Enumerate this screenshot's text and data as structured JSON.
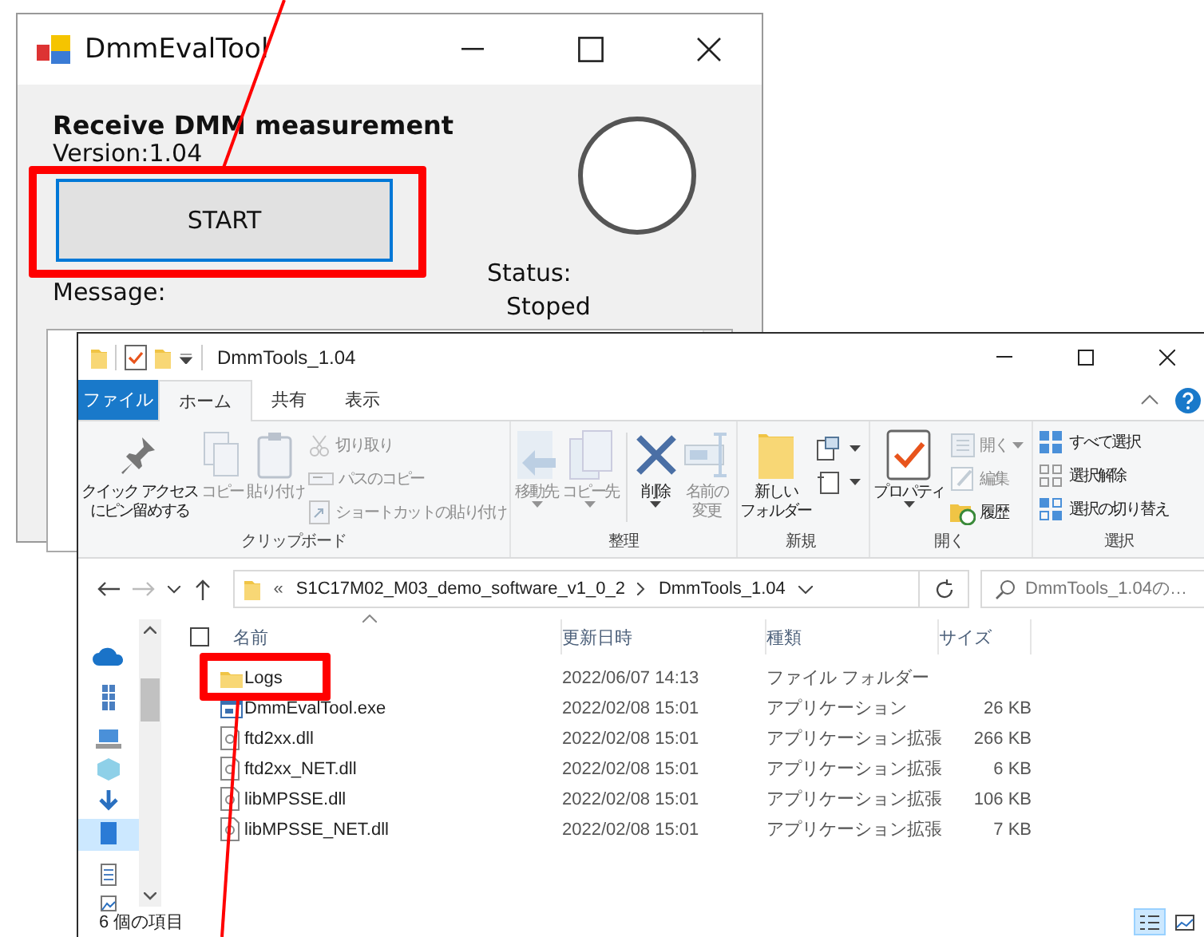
{
  "app_window": {
    "title": "DmmEvalTool",
    "heading": "Receive DMM measurement",
    "version": "Version:1.04",
    "start_button": "START",
    "status_label": "Status:",
    "status_value": "Stoped",
    "message_label": "Message:"
  },
  "explorer": {
    "title": "DmmTools_1.04",
    "ribbon_tabs": [
      {
        "label": "ファイル",
        "kind": "file",
        "selected": false
      },
      {
        "label": "ホーム",
        "kind": "tab",
        "selected": true
      },
      {
        "label": "共有",
        "kind": "tab",
        "selected": false
      },
      {
        "label": "表示",
        "kind": "tab",
        "selected": false
      }
    ],
    "ribbon_groups": [
      {
        "label": "クリップボード",
        "commands": [
          {
            "lines": [
              "クイック アクセス",
              "にピン留めする"
            ],
            "kind": "large",
            "disabled": false
          },
          {
            "lines": [
              "コピー"
            ],
            "kind": "large",
            "disabled": true
          },
          {
            "lines": [
              "貼り付け"
            ],
            "kind": "large",
            "disabled": true
          },
          {
            "label": "切り取り",
            "kind": "small",
            "disabled": true
          },
          {
            "label": "パスのコピー",
            "kind": "small",
            "disabled": true
          },
          {
            "label": "ショートカットの貼り付け",
            "kind": "small",
            "disabled": true
          }
        ]
      },
      {
        "label": "整理",
        "commands": [
          {
            "lines": [
              "移動先"
            ],
            "kind": "large",
            "disabled": true,
            "dropdown": true
          },
          {
            "lines": [
              "コピー先"
            ],
            "kind": "large",
            "disabled": true,
            "dropdown": true
          },
          {
            "lines": [
              "削除"
            ],
            "kind": "large",
            "disabled": false,
            "dropdown": true
          },
          {
            "lines": [
              "名前の",
              "変更"
            ],
            "kind": "large",
            "disabled": true
          }
        ]
      },
      {
        "label": "新規",
        "commands": [
          {
            "lines": [
              "新しい",
              "フォルダー"
            ],
            "kind": "large",
            "disabled": false
          },
          {
            "kind": "icon",
            "disabled": false,
            "dropdown": true
          },
          {
            "kind": "icon",
            "disabled": false,
            "dropdown": true
          }
        ]
      },
      {
        "label": "開く",
        "commands": [
          {
            "lines": [
              "プロパティ"
            ],
            "kind": "large",
            "disabled": false,
            "dropdown": true
          },
          {
            "label": "開く",
            "kind": "small",
            "disabled": true,
            "dropdown": true
          },
          {
            "label": "編集",
            "kind": "small",
            "disabled": true
          },
          {
            "label": "履歴",
            "kind": "small",
            "disabled": false
          }
        ]
      },
      {
        "label": "選択",
        "commands": [
          {
            "label": "すべて選択",
            "kind": "small",
            "disabled": false
          },
          {
            "label": "選択解除",
            "kind": "small",
            "disabled": false
          },
          {
            "label": "選択の切り替え",
            "kind": "small",
            "disabled": false
          }
        ]
      }
    ],
    "address": {
      "overflow": "«",
      "path": [
        "S1C17M02_M03_demo_software_v1_0_2",
        "DmmTools_1.04"
      ]
    },
    "search": {
      "placeholder": "DmmTools_1.04の…"
    },
    "select_all_checked": false,
    "columns": [
      "名前",
      "更新日時",
      "種類",
      "サイズ"
    ],
    "rows": [
      {
        "kind": "folder",
        "name": "Logs",
        "modified": "2022/06/07 14:13",
        "type": "ファイル フォルダー",
        "size": ""
      },
      {
        "kind": "exe",
        "name": "DmmEvalTool.exe",
        "modified": "2022/02/08 15:01",
        "type": "アプリケーション",
        "size": "26 KB"
      },
      {
        "kind": "dll",
        "name": "ftd2xx.dll",
        "modified": "2022/02/08 15:01",
        "type": "アプリケーション拡張",
        "size": "266 KB"
      },
      {
        "kind": "dll",
        "name": "ftd2xx_NET.dll",
        "modified": "2022/02/08 15:01",
        "type": "アプリケーション拡張",
        "size": "6 KB"
      },
      {
        "kind": "dll",
        "name": "libMPSSE.dll",
        "modified": "2022/02/08 15:01",
        "type": "アプリケーション拡張",
        "size": "106 KB"
      },
      {
        "kind": "dll",
        "name": "libMPSSE_NET.dll",
        "modified": "2022/02/08 15:01",
        "type": "アプリケーション拡張",
        "size": "7 KB"
      }
    ],
    "status_bar": "6 個の項目"
  }
}
